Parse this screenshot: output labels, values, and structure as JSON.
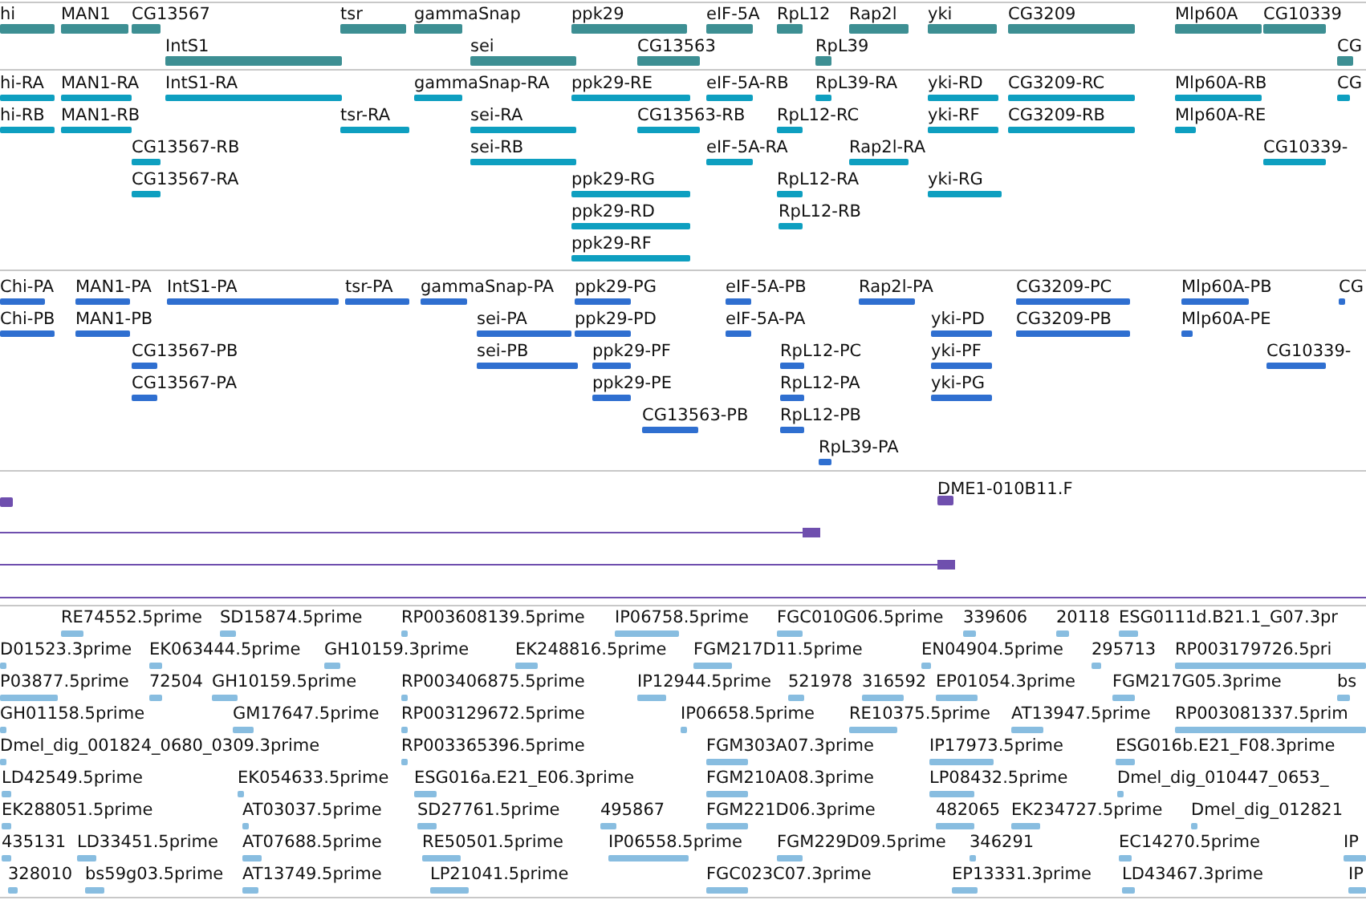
{
  "tracks": [
    {
      "kind": "gene",
      "features": [
        "hi",
        "MAN1",
        "CG13567",
        "tsr",
        "gammaSnap",
        "ppk29",
        "eIF-5A",
        "RpL12",
        "Rap2l",
        "yki",
        "CG3209",
        "Mlp60A",
        "CG10339",
        "IntS1",
        "sei",
        "CG13563",
        "RpL39",
        "CG"
      ]
    },
    {
      "kind": "transcript",
      "features": [
        "hi-RA",
        "MAN1-RA",
        "IntS1-RA",
        "gammaSnap-RA",
        "ppk29-RE",
        "eIF-5A-RB",
        "RpL39-RA",
        "yki-RD",
        "CG3209-RC",
        "Mlp60A-RB",
        "CG",
        "hi-RB",
        "MAN1-RB",
        "tsr-RA",
        "sei-RA",
        "CG13563-RB",
        "RpL12-RC",
        "yki-RF",
        "CG3209-RB",
        "Mlp60A-RE",
        "CG13567-RB",
        "sei-RB",
        "eIF-5A-RA",
        "Rap2l-RA",
        "CG10339-",
        "CG13567-RA",
        "ppk29-RG",
        "RpL12-RA",
        "yki-RG",
        "ppk29-RD",
        "RpL12-RB",
        "ppk29-RF"
      ]
    },
    {
      "kind": "protein",
      "features": [
        "Chi-PA",
        "MAN1-PA",
        "IntS1-PA",
        "tsr-PA",
        "gammaSnap-PA",
        "ppk29-PG",
        "eIF-5A-PB",
        "Rap2l-PA",
        "CG3209-PC",
        "Mlp60A-PB",
        "CG",
        "Chi-PB",
        "MAN1-PB",
        "sei-PA",
        "ppk29-PD",
        "eIF-5A-PA",
        "yki-PD",
        "CG3209-PB",
        "Mlp60A-PE",
        "CG13567-PB",
        "sei-PB",
        "ppk29-PF",
        "RpL12-PC",
        "yki-PF",
        "CG10339-",
        "CG13567-PA",
        "ppk29-PE",
        "RpL12-PA",
        "yki-PG",
        "CG13563-PB",
        "RpL12-PB",
        "RpL39-PA"
      ]
    },
    {
      "kind": "clone",
      "features": [
        "DME1-010B11.F"
      ]
    },
    {
      "kind": "est",
      "features": [
        "RE74552.5prime",
        "SD15874.5prime",
        "RP003608139.5prime",
        "IP06758.5prime",
        "FGC010G06.5prime",
        "339606",
        "20118",
        "ESG0111d.B21.1_G07.3pr",
        "D01523.3prime",
        "EK063444.5prime",
        "GH10159.3prime",
        "EK248816.5prime",
        "FGM217D11.5prime",
        "EN04904.5prime",
        "295713",
        "RP003179726.5pri",
        "P03877.5prime",
        "72504",
        "GH10159.5prime",
        "RP003406875.5prime",
        "IP12944.5prime",
        "521978",
        "316592",
        "EP01054.3prime",
        "FGM217G05.3prime",
        "bs",
        "GH01158.5prime",
        "GM17647.5prime",
        "RP003129672.5prime",
        "IP06658.5prime",
        "RE10375.5prime",
        "AT13947.5prime",
        "RP003081337.5prim",
        "Dmel_dig_001824_0680_0309.3prime",
        "RP003365396.5prime",
        "FGM303A07.3prime",
        "IP17973.5prime",
        "ESG016b.E21_F08.3prime",
        "LD42549.5prime",
        "EK054633.5prime",
        "ESG016a.E21_E06.3prime",
        "FGM210A08.3prime",
        "LP08432.5prime",
        "Dmel_dig_010447_0653_",
        "EK288051.5prime",
        "AT03037.5prime",
        "SD27761.5prime",
        "495867",
        "FGM221D06.3prime",
        "482065",
        "EK234727.5prime",
        "Dmel_dig_012821",
        "435131",
        "LD33451.5prime",
        "AT07688.5prime",
        "RE50501.5prime",
        "IP06558.5prime",
        "FGM229D09.5prime",
        "346291",
        "EC14270.5prime",
        "IP",
        "328010",
        "bs59g03.5prime",
        "AT13749.5prime",
        "LP21041.5prime",
        "FGC023C07.3prime",
        "EP13331.3prime",
        "LD43467.3prime",
        "IP"
      ]
    }
  ]
}
